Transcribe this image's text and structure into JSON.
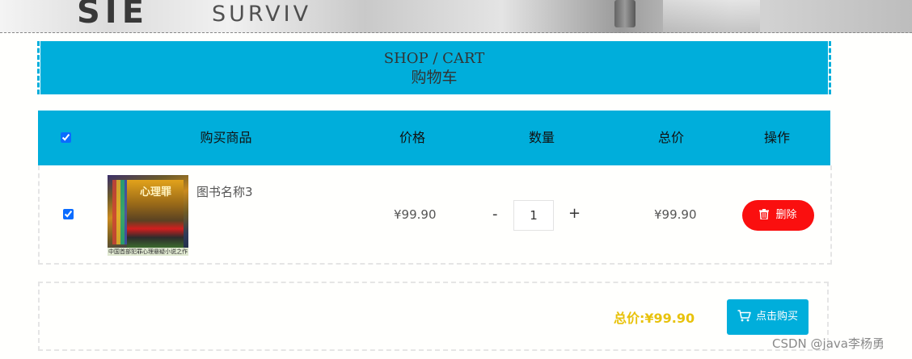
{
  "banner": {
    "text_big": "SIE",
    "text_small": "SURVIV"
  },
  "header": {
    "title_en": "SHOP / CART",
    "title_cn": "购物车"
  },
  "table": {
    "columns": {
      "product": "购买商品",
      "price": "价格",
      "quantity": "数量",
      "total": "总价",
      "action": "操作"
    },
    "select_all_checked": true
  },
  "items": [
    {
      "checked": true,
      "name": "图书名称3",
      "cover_title": "心理罪",
      "cover_caption": "中国首部犯罪心理悬疑小说之作",
      "price": "¥99.90",
      "quantity": "1",
      "minus": "-",
      "plus": "+",
      "subtotal": "¥99.90",
      "delete_label": "删除"
    }
  ],
  "footer": {
    "total_label": "总价:",
    "total_value": "¥99.90",
    "buy_label": "点击购买"
  },
  "watermark": "CSDN @java李杨勇",
  "colors": {
    "primary": "#00aedb",
    "danger": "#fa0f0f",
    "total": "#e8c20b"
  }
}
